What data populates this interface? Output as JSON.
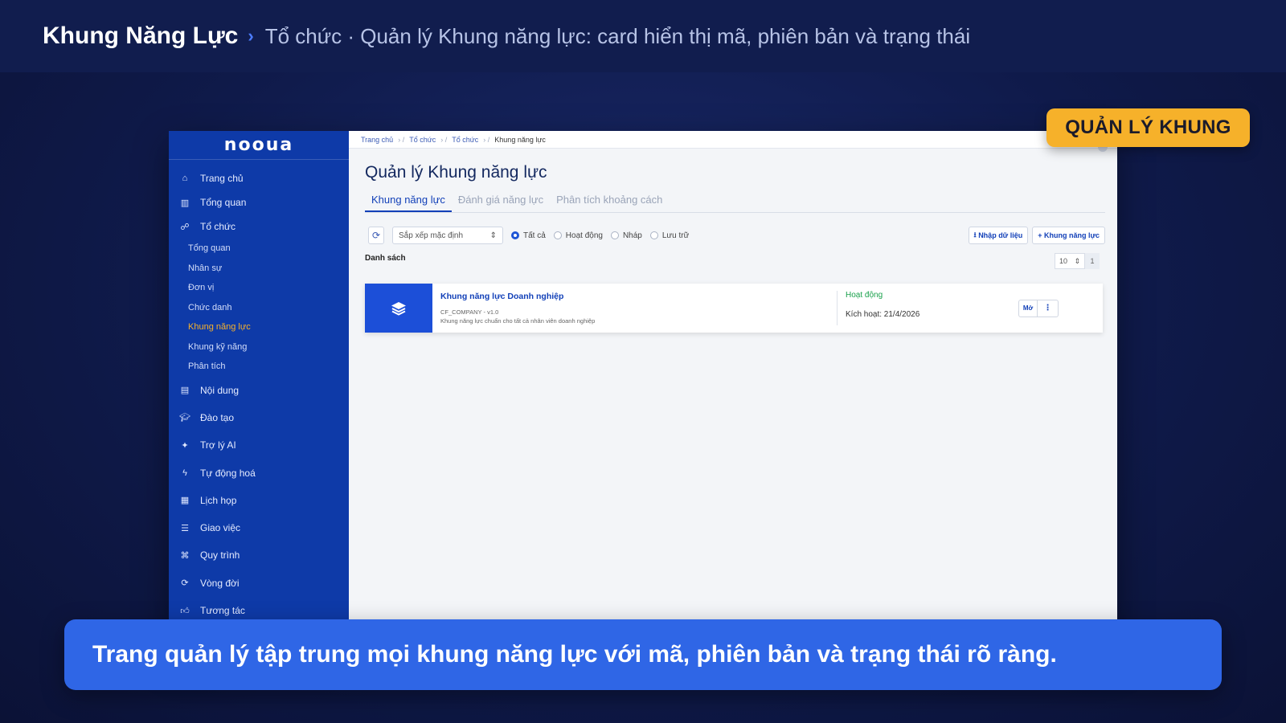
{
  "header": {
    "title": "Khung Năng Lực",
    "subtitle": "Tổ chức · Quản lý Khung năng lực: card hiển thị mã, phiên bản và trạng thái"
  },
  "badge": "QUẢN LÝ KHUNG",
  "caption": "Trang quản lý tập trung mọi khung năng lực với mã, phiên bản và trạng thái rõ ràng.",
  "app": {
    "logo": "nooua",
    "breadcrumb": [
      "Trang chủ",
      "Tổ chức",
      "Tổ chức",
      "Khung năng lực"
    ],
    "sidebar": {
      "items": [
        {
          "label": "Trang chủ",
          "icon": "home-icon"
        },
        {
          "label": "Tổng quan",
          "icon": "chart-icon"
        },
        {
          "label": "Tổ chức",
          "icon": "org-icon"
        }
      ],
      "sub_items": [
        "Tổng quan",
        "Nhân sự",
        "Đơn vị",
        "Chức danh",
        "Khung năng lực",
        "Khung kỹ năng",
        "Phân tích"
      ],
      "lower_items": [
        {
          "label": "Nội dung",
          "icon": "book-icon"
        },
        {
          "label": "Đào tạo",
          "icon": "graduation-icon"
        },
        {
          "label": "Trợ lý AI",
          "icon": "sparkle-icon"
        },
        {
          "label": "Tự động hoá",
          "icon": "bolt-icon"
        },
        {
          "label": "Lịch họp",
          "icon": "calendar-icon"
        },
        {
          "label": "Giao việc",
          "icon": "tasks-icon"
        },
        {
          "label": "Quy trình",
          "icon": "workflow-icon"
        },
        {
          "label": "Vòng đời",
          "icon": "cycle-icon"
        },
        {
          "label": "Tương tác",
          "icon": "thumbs-up-icon"
        }
      ]
    },
    "page_title": "Quản lý Khung năng lực",
    "tabs": [
      "Khung năng lực",
      "Đánh giá năng lực",
      "Phân tích khoảng cách"
    ],
    "sort_select": "Sắp xếp mặc định",
    "filters": [
      "Tất cả",
      "Hoạt động",
      "Nháp",
      "Lưu trữ"
    ],
    "import_button": "Nhập dữ liệu",
    "add_button": "+ Khung năng lực",
    "list_label": "Danh sách",
    "page_size": "10",
    "page_number": "1",
    "card": {
      "name": "Khung năng lực Doanh nghiệp",
      "code": "CF_COMPANY - v1.0",
      "description": "Khung năng lực chuẩn cho tất cả nhân viên doanh nghiệp",
      "status": "Hoạt động",
      "activated": "Kích hoạt: 21/4/2026",
      "open_button": "Mở",
      "more_button": "⋮"
    }
  },
  "colors": {
    "accent": "#f6b12a",
    "primary": "#1240b8",
    "sidebar": "#0e3aa8",
    "caption_bg": "#2f66e6",
    "status_active": "#18a04a"
  }
}
